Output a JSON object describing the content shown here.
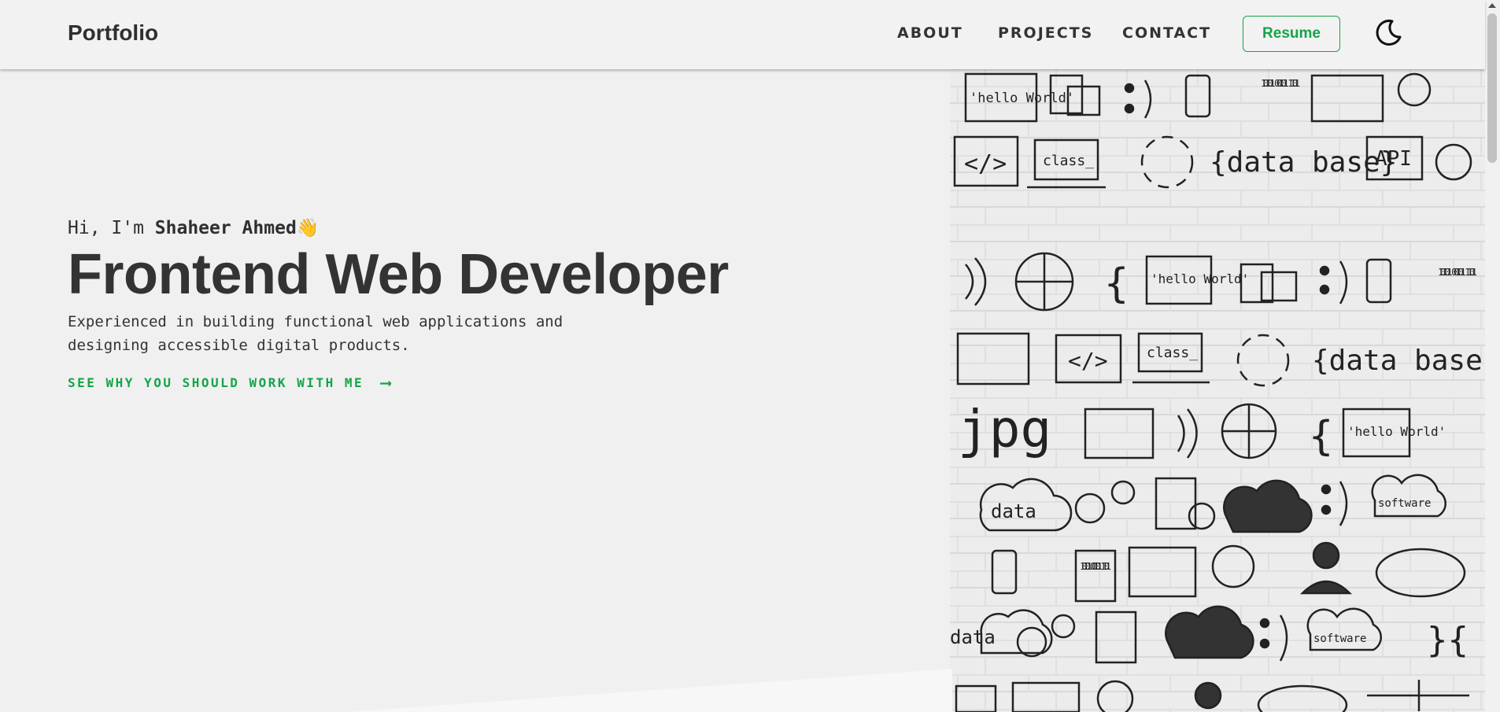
{
  "nav": {
    "brand": "Portfolio",
    "links": [
      "ABOUT",
      "PROJECTS",
      "CONTACT"
    ],
    "resume_label": "Resume",
    "theme_icon": "moon-icon"
  },
  "hero": {
    "greeting_prefix": "Hi, I'm ",
    "name": "Shaheer Ahmed",
    "wave_emoji": "👋",
    "headline": "Frontend Web Developer",
    "description": "Experienced in building functional web applications and designing accessible digital products.",
    "cta_label": "SEE WHY YOU SHOULD WORK WITH ME",
    "cta_arrow": "⟶"
  },
  "hero_image": {
    "doodles": [
      "'hello World'",
      "class_",
      "{data base}",
      "API",
      "jpg",
      "data",
      "software",
      "10101 00101 1101",
      "</>",
      ";)"
    ]
  },
  "colors": {
    "accent": "#16a34a",
    "text": "#333333",
    "background": "#f0f0f0"
  }
}
